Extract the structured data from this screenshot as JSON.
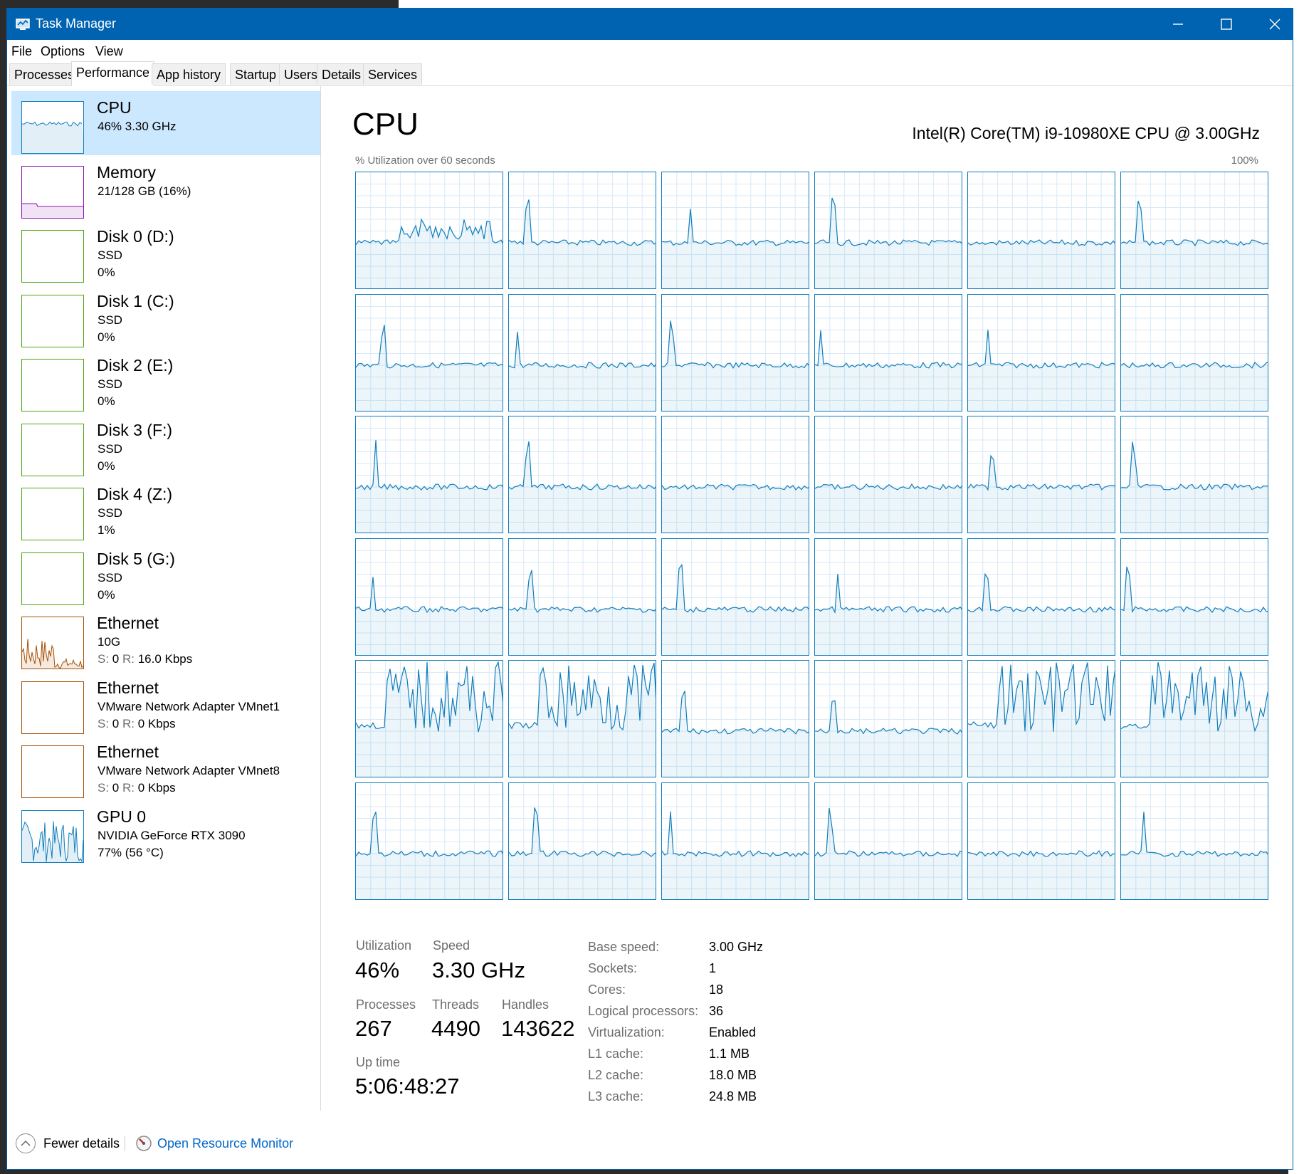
{
  "window": {
    "title": "Task Manager",
    "accent": "#0063b1"
  },
  "menu": [
    "File",
    "Options",
    "View"
  ],
  "tabs": [
    "Processes",
    "Performance",
    "App history",
    "Startup",
    "Users",
    "Details",
    "Services"
  ],
  "active_tab": "Performance",
  "sidebar": [
    {
      "name": "CPU",
      "line1": "46%  3.30 GHz",
      "color": "#117dbb",
      "selected": true
    },
    {
      "name": "Memory",
      "line1": "21/128 GB (16%)",
      "color": "#8b12ae"
    },
    {
      "name": "Disk 0 (D:)",
      "line1": "SSD",
      "line2": "0%",
      "color": "#4da60c"
    },
    {
      "name": "Disk 1 (C:)",
      "line1": "SSD",
      "line2": "0%",
      "color": "#4da60c"
    },
    {
      "name": "Disk 2 (E:)",
      "line1": "SSD",
      "line2": "0%",
      "color": "#4da60c"
    },
    {
      "name": "Disk 3 (F:)",
      "line1": "SSD",
      "line2": "0%",
      "color": "#4da60c"
    },
    {
      "name": "Disk 4 (Z:)",
      "line1": "SSD",
      "line2": "1%",
      "color": "#4da60c"
    },
    {
      "name": "Disk 5 (G:)",
      "line1": "SSD",
      "line2": "0%",
      "color": "#4da60c"
    },
    {
      "name": "Ethernet",
      "line1": "10G",
      "line2_s": "S:",
      "line2_sv": " 0 ",
      "line2_r": "R:",
      "line2_rv": " 16.0 Kbps",
      "color": "#a74f01"
    },
    {
      "name": "Ethernet",
      "line1": "VMware Network Adapter VMnet1",
      "line2_s": "S:",
      "line2_sv": " 0 ",
      "line2_r": "R:",
      "line2_rv": " 0 Kbps",
      "color": "#a74f01"
    },
    {
      "name": "Ethernet",
      "line1": "VMware Network Adapter VMnet8",
      "line2_s": "S:",
      "line2_sv": " 0 ",
      "line2_r": "R:",
      "line2_rv": " 0 Kbps",
      "color": "#a74f01"
    },
    {
      "name": "GPU 0",
      "line1": "NVIDIA GeForce RTX 3090",
      "line2": "77%  (56 °C)",
      "color": "#117dbb"
    }
  ],
  "cpu": {
    "title": "CPU",
    "model": "Intel(R) Core(TM) i9-10980XE CPU @ 3.00GHz",
    "util_label": "% Utilization over 60 seconds",
    "util_max": "100%",
    "logical_processors_shown": 36,
    "stats": {
      "utilization_label": "Utilization",
      "utilization": "46%",
      "speed_label": "Speed",
      "speed": "3.30 GHz",
      "processes_label": "Processes",
      "processes": "267",
      "threads_label": "Threads",
      "threads": "4490",
      "handles_label": "Handles",
      "handles": "143622",
      "uptime_label": "Up time",
      "uptime": "5:06:48:27"
    },
    "specs": [
      {
        "label": "Base speed:",
        "value": "3.00 GHz"
      },
      {
        "label": "Sockets:",
        "value": "1"
      },
      {
        "label": "Cores:",
        "value": "18"
      },
      {
        "label": "Logical processors:",
        "value": "36"
      },
      {
        "label": "Virtualization:",
        "value": "Enabled"
      },
      {
        "label": "L1 cache:",
        "value": "1.1 MB"
      },
      {
        "label": "L2 cache:",
        "value": "18.0 MB"
      },
      {
        "label": "L3 cache:",
        "value": "24.8 MB"
      }
    ]
  },
  "footer": {
    "fewer_details": "Fewer details",
    "resource_monitor": "Open Resource Monitor"
  }
}
